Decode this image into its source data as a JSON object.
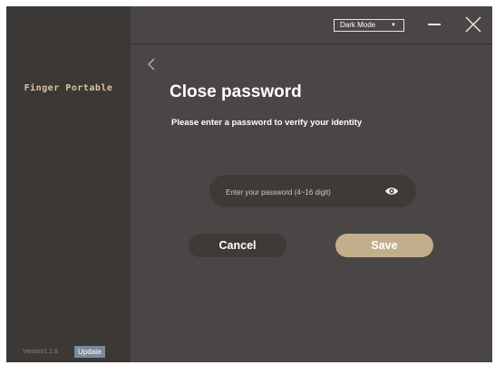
{
  "sidebar": {
    "brand": "Finger Portable",
    "version": "Version1.1.8",
    "update_label": "Update"
  },
  "topbar": {
    "theme_select": "Dark Mode",
    "theme_caret": "▼"
  },
  "main": {
    "title": "Close password",
    "subtitle": "Please enter a password to verify your identity",
    "password_placeholder": "Enter your password (4~16 digit)",
    "cancel_label": "Cancel",
    "save_label": "Save"
  },
  "colors": {
    "background": "#4a4645",
    "sidebar": "#3b3836",
    "accent": "#c3ae8c",
    "field": "#3d3a38"
  },
  "icons": [
    "chevron-left-icon",
    "minimize-icon",
    "close-icon",
    "eye-icon"
  ]
}
